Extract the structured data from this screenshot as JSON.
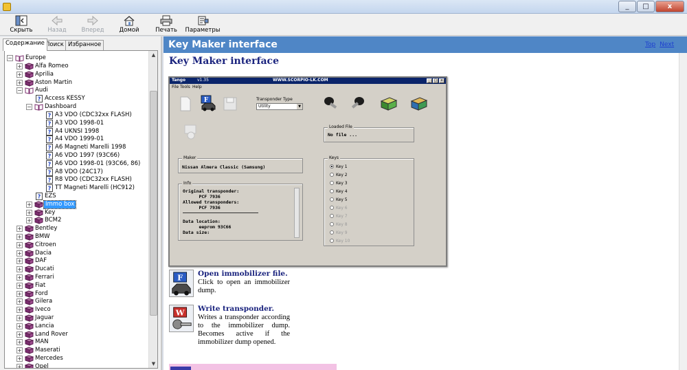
{
  "window": {
    "minimize": "_",
    "maximize": "□",
    "close": "x"
  },
  "toolbar": {
    "hide": "Скрыть",
    "back": "Назад",
    "forward": "Вперед",
    "home": "Домой",
    "print": "Печать",
    "options": "Параметры"
  },
  "tabs": {
    "contents": "Содержание",
    "search": "Поиск",
    "favorites": "Избранное"
  },
  "tree": {
    "europe": "Europe",
    "alfa": "Alfa Romeo",
    "aprilia": "Aprilia",
    "aston": "Aston Martin",
    "audi": "Audi",
    "access_kessy": "Access KESSY",
    "dashboard": "Dashboard",
    "a3_vdo_cdc": "A3 VDO (CDC32xx FLASH)",
    "a3_vdo_1998": "A3 VDO 1998-01",
    "a4_ukns": "A4 UKNSI 1998",
    "a4_vdo": "A4 VDO 1999-01",
    "a6_mm": "A6 Magneti Marelli 1998",
    "a6_vdo_1997": "A6 VDO 1997 (93C66)",
    "a6_vdo_1998": "A6 VDO 1998-01 (93C66, 86)",
    "a8_vdo": "A8 VDO (24C17)",
    "r8_vdo": "R8 VDO (CDC32xx FLASH)",
    "tt_mm": "TT Magneti Marelli (HC912)",
    "ezs": "EZS",
    "immo_box": "Immo box",
    "key": "Key",
    "bcm2": "BCM2",
    "bentley": "Bentley",
    "bmw": "BMW",
    "citroen": "Citroen",
    "dacia": "Dacia",
    "daf": "DAF",
    "ducati": "Ducati",
    "ferrari": "Ferrari",
    "fiat": "Fiat",
    "ford": "Ford",
    "gilera": "Gilera",
    "iveco": "Iveco",
    "jaguar": "Jaguar",
    "lancia": "Lancia",
    "land_rover": "Land Rover",
    "man": "MAN",
    "maserati": "Maserati",
    "mercedes": "Mercedes",
    "opel": "Opel"
  },
  "content": {
    "topic_title": "Key Maker interface",
    "link_top": "Top",
    "link_next": "Next",
    "page_title": "Key Maker interface"
  },
  "app": {
    "title": "Tango",
    "version": "v1.35",
    "website": "WWW.SCORPIO-LK.COM",
    "menu_file": "File",
    "menu_tools": "Tools",
    "menu_help": "Help",
    "transponder_type_label": "Transponder Type",
    "transponder_type_value": "Utility",
    "loaded_file_label": "Loaded File",
    "loaded_file_value": "No file ...",
    "maker_label": "Maker",
    "maker_value": "Nissan Almera Classic (Samsung)",
    "info_label": "Info",
    "info_lines": {
      "l1": "Original transponder:",
      "l2": "      PCF 7936",
      "l3": "Allowed transponders:",
      "l4": "      PCF 7936",
      "l5": "Data location:",
      "l6": "      eeprom 93C66",
      "l7": "Data size:"
    },
    "keys_label": "Keys",
    "keys": [
      "Key 1",
      "Key 2",
      "Key 3",
      "Key 4",
      "Key 5",
      "Key 6",
      "Key 7",
      "Key 8",
      "Key 9",
      "Key 10"
    ]
  },
  "features": {
    "open_title": "Open immobilizer file.",
    "open_text": "Click to open an immobilizer dump.",
    "write_title": "Write transponder.",
    "write_text": "Writes a transponder according to the immobilizer dump. Becomes active if the immobilizer dump opened."
  },
  "colors": {
    "topic_bar": "#4f86c6",
    "heading": "#1a237e",
    "selection": "#3399ff",
    "book": "#7b2d6e"
  }
}
